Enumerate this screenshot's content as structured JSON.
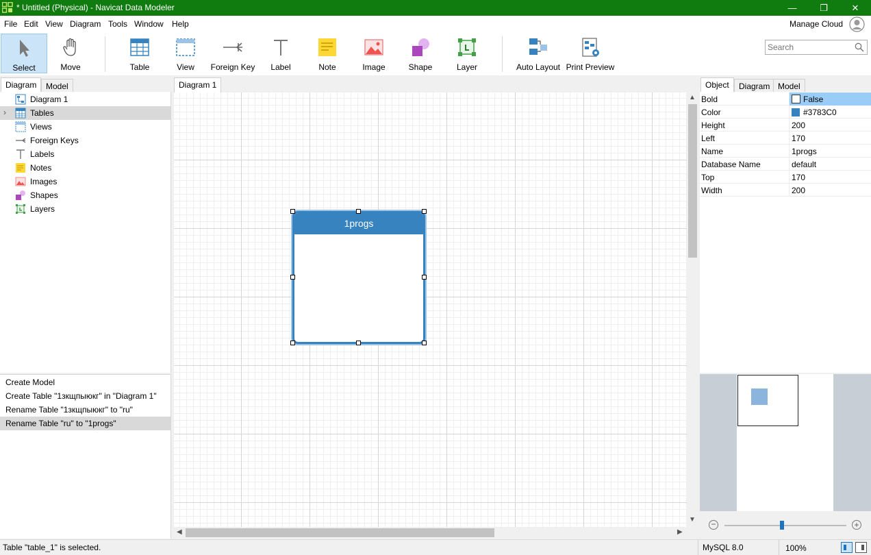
{
  "window": {
    "title": "* Untitled (Physical) - Navicat Data Modeler",
    "minimize": "—",
    "maximize": "❐",
    "close": "✕",
    "titlebar_color": "#107c10"
  },
  "menu": [
    "File",
    "Edit",
    "View",
    "Diagram",
    "Tools",
    "Window",
    "Help"
  ],
  "account": {
    "label": "Manage Cloud"
  },
  "toolbar": {
    "tools": [
      {
        "id": "select",
        "label": "Select",
        "icon": "cursor-icon",
        "active": true
      },
      {
        "id": "move",
        "label": "Move",
        "icon": "hand-icon"
      },
      {
        "id": "table",
        "label": "Table",
        "icon": "table-icon"
      },
      {
        "id": "view",
        "label": "View",
        "icon": "view-icon"
      },
      {
        "id": "foreignkey",
        "label": "Foreign Key",
        "icon": "foreign-key-icon"
      },
      {
        "id": "label",
        "label": "Label",
        "icon": "label-icon"
      },
      {
        "id": "note",
        "label": "Note",
        "icon": "note-icon"
      },
      {
        "id": "image",
        "label": "Image",
        "icon": "image-icon"
      },
      {
        "id": "shape",
        "label": "Shape",
        "icon": "shape-icon"
      },
      {
        "id": "layer",
        "label": "Layer",
        "icon": "layer-icon"
      },
      {
        "id": "autolayout",
        "label": "Auto Layout",
        "icon": "auto-layout-icon"
      },
      {
        "id": "printpreview",
        "label": "Print Preview",
        "icon": "print-preview-icon"
      }
    ]
  },
  "search": {
    "placeholder": "Search",
    "value": ""
  },
  "left": {
    "tabs": [
      "Diagram",
      "Model"
    ],
    "tree": [
      {
        "label": "Diagram 1",
        "icon": "diagram-icon"
      },
      {
        "label": "Tables",
        "icon": "tables-icon",
        "selected": true,
        "expandable": true
      },
      {
        "label": "Views",
        "icon": "views-icon"
      },
      {
        "label": "Foreign Keys",
        "icon": "foreign-keys-icon"
      },
      {
        "label": "Labels",
        "icon": "labels-icon"
      },
      {
        "label": "Notes",
        "icon": "notes-icon"
      },
      {
        "label": "Images",
        "icon": "images-icon"
      },
      {
        "label": "Shapes",
        "icon": "shapes-icon"
      },
      {
        "label": "Layers",
        "icon": "layers-icon"
      }
    ],
    "history": [
      {
        "label": "Create Model"
      },
      {
        "label": "Create Table \"1зкщпыюкг\" in \"Diagram 1\""
      },
      {
        "label": "Rename Table \"1зкщпыюкг\" to \"ru\""
      },
      {
        "label": "Rename Table \"ru\" to \"1progs\"",
        "selected": true
      }
    ]
  },
  "canvas": {
    "tab": "Diagram 1",
    "entity": {
      "name": "1progs",
      "color": "#3783C0"
    }
  },
  "right": {
    "tabs": [
      "Object",
      "Diagram",
      "Model"
    ],
    "properties": [
      {
        "key": "Bold",
        "value": "False",
        "type": "checkbox"
      },
      {
        "key": "Color",
        "value": "#3783C0",
        "type": "color"
      },
      {
        "key": "Height",
        "value": "200"
      },
      {
        "key": "Left",
        "value": "170"
      },
      {
        "key": "Name",
        "value": "1progs"
      },
      {
        "key": "Database Name",
        "value": "default"
      },
      {
        "key": "Top",
        "value": "170"
      },
      {
        "key": "Width",
        "value": "200"
      }
    ]
  },
  "status": {
    "message": "Table \"table_1\" is selected.",
    "db": "MySQL 8.0",
    "zoom": "100%",
    "zoom_minus": "−",
    "zoom_plus": "+"
  }
}
